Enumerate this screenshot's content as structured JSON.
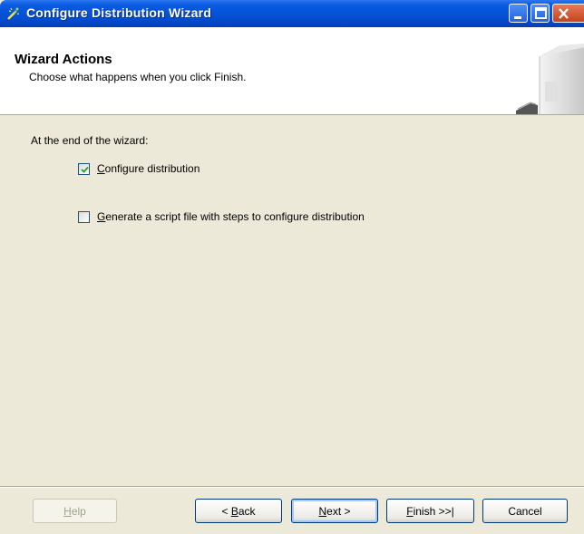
{
  "window": {
    "title": "Configure Distribution Wizard"
  },
  "header": {
    "title": "Wizard Actions",
    "subtitle": "Choose what happens when you click Finish."
  },
  "content": {
    "prompt": "At the end of the wizard:",
    "options": [
      {
        "mnemonic": "C",
        "rest": "onfigure distribution",
        "checked": true
      },
      {
        "mnemonic": "G",
        "rest": "enerate a script file with steps to configure distribution",
        "checked": false
      }
    ]
  },
  "buttons": {
    "help": {
      "mnemonic": "H",
      "rest": "elp",
      "enabled": false
    },
    "back": {
      "prefix": "< ",
      "mnemonic": "B",
      "rest": "ack"
    },
    "next": {
      "mnemonic": "N",
      "rest": "ext >"
    },
    "finish": {
      "mnemonic": "F",
      "rest": "inish >>|"
    },
    "cancel": {
      "label": "Cancel"
    }
  },
  "colors": {
    "titlebar": "#0453d8",
    "dialog_bg": "#ece9d8",
    "header_bg": "#ffffff",
    "checkmark": "#21a121"
  }
}
